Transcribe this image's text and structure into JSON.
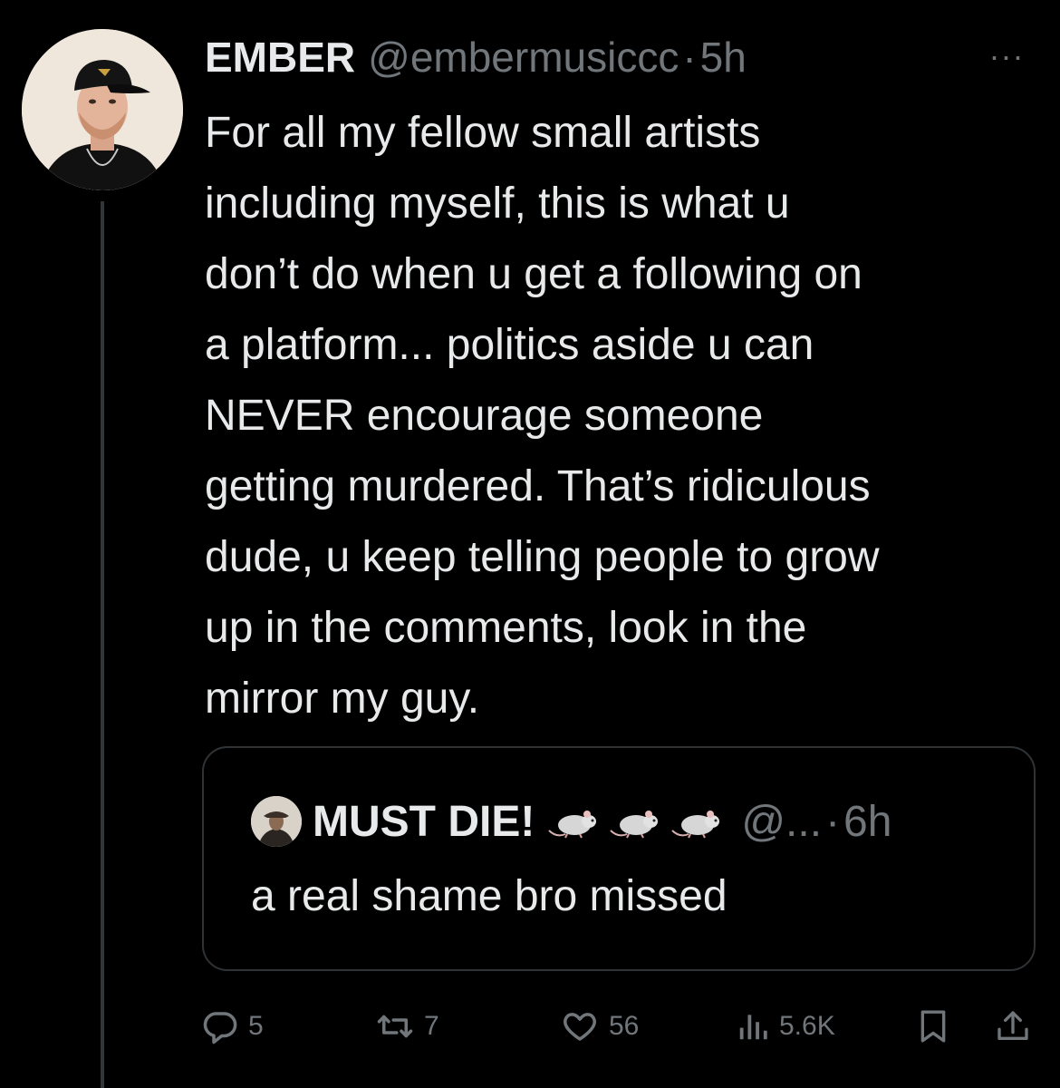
{
  "tweet": {
    "display_name": "EMBER",
    "handle": "@embermusiccc",
    "separator": "·",
    "time": "5h",
    "more_label": "···",
    "text": "For all my fellow small artists\nincluding myself, this is what u\ndon’t do when u get a following on\na platform... politics aside u can\nNEVER encourage someone\ngetting murdered. That’s ridiculous\ndude, u keep telling people to grow\nup in the comments, look in the\nmirror my guy.",
    "avatar_icon": "profile-photo-man-in-cap"
  },
  "quote": {
    "display_name": "MUST DIE!",
    "name_emoji": [
      "rat",
      "rat",
      "rat"
    ],
    "handle": "@...",
    "separator": "·",
    "time": "6h",
    "text": "a real shame bro missed",
    "avatar_icon": "profile-photo-small"
  },
  "actions": {
    "reply_count": "5",
    "retweet_count": "7",
    "like_count": "56",
    "views_count": "5.6K",
    "reply_icon": "reply-icon",
    "retweet_icon": "retweet-icon",
    "like_icon": "heart-icon",
    "views_icon": "views-icon",
    "bookmark_icon": "bookmark-icon",
    "share_icon": "share-icon"
  },
  "colors": {
    "background": "#000000",
    "primary_text": "#e7e9ea",
    "secondary_text": "#71767b",
    "border": "#2f3336"
  }
}
